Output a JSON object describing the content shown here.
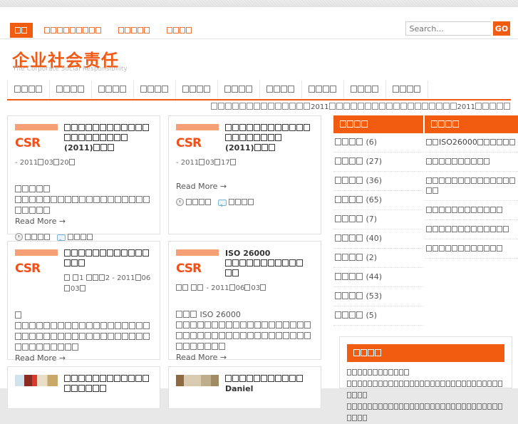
{
  "site": {
    "logo_cn": "企业社会责任",
    "logo_en": "The Corporate Social Responsibility",
    "accent_color": "#f25c11",
    "accent_dark": "#f05a14",
    "thumb_bar_color": "#f5a076"
  },
  "topbar": {
    "items": [
      {
        "label": "□□",
        "len": 2,
        "active": true
      },
      {
        "label": "□□□□□□□□□",
        "len": 9,
        "active": false
      },
      {
        "label": "□□□□□",
        "len": 5,
        "active": false
      },
      {
        "label": "□□□□",
        "len": 4,
        "active": false
      }
    ],
    "search": {
      "placeholder": "Search...",
      "value": "",
      "go_label": "GO"
    }
  },
  "mainnav": {
    "items": [
      {
        "label": "□□□□",
        "len": 4
      },
      {
        "label": "□□□□",
        "len": 4
      },
      {
        "label": "□□□□",
        "len": 4
      },
      {
        "label": "□□□□",
        "len": 4
      },
      {
        "label": "□□□□",
        "len": 4
      },
      {
        "label": "□□□□",
        "len": 4
      },
      {
        "label": "□□□□",
        "len": 4
      },
      {
        "label": "□□□□",
        "len": 4
      },
      {
        "label": "□□□□",
        "len": 4
      },
      {
        "label": "□□□□",
        "len": 4
      }
    ]
  },
  "ticker": {
    "segments": [
      {
        "type": "tofu",
        "len": 14
      },
      {
        "type": "text",
        "text": "2011"
      },
      {
        "type": "tofu",
        "len": 18
      },
      {
        "type": "text",
        "text": "2011"
      },
      {
        "type": "tofu",
        "len": 5
      }
    ]
  },
  "articles": [
    {
      "thumb": "csr-logo",
      "title_tofu": 21,
      "title_tail": "(2011)",
      "title_tofu2": 3,
      "date": "- 2011□03□20□",
      "date_prefix_tofu": 0,
      "excerpt_tofu_a": 5,
      "excerpt_tofu_b": 24,
      "read_more": "Read More →",
      "meta_time_tofu": 4,
      "meta_comment_tofu": 4
    },
    {
      "thumb": "csr-logo",
      "title_tofu": 20,
      "title_tail": "(2011)",
      "title_tofu2": 3,
      "date": "- 2011□03□17□",
      "date_prefix_tofu": 0,
      "excerpt_tofu_a": 0,
      "excerpt_tofu_b": 0,
      "read_more": "Read More →",
      "meta_time_tofu": 4,
      "meta_comment_tofu": 4
    },
    {
      "thumb": "csr-logo",
      "title_tofu": 15,
      "title_tail": "",
      "title_tofu2": 0,
      "date": "□ □1 □□□2 - 2011□06□03□",
      "date_prefix_tofu": 0,
      "excerpt_tofu_a": 1,
      "excerpt_tofu_b": 47,
      "read_more": "Read More →",
      "meta_time_tofu": 4,
      "meta_comment_tofu": 4
    },
    {
      "thumb": "csr-logo",
      "title_lead": "ISO 26000",
      "title_tofu": 11,
      "title_tail": "",
      "title_tofu2": 2,
      "date": "□□ □□ - 2011□06□03□",
      "date_prefix_tofu": 0,
      "excerpt_lead": "ISO 26000",
      "excerpt_tofu_a": 3,
      "excerpt_tofu_b": 45,
      "read_more": "Read More →",
      "meta_time_tofu": 4,
      "meta_comment_tofu": 4
    },
    {
      "thumb": "photo-1",
      "title_tofu": 18,
      "title_tail": "",
      "title_tofu2": 0,
      "date": "",
      "excerpt_tofu_a": 0,
      "excerpt_tofu_b": 0,
      "read_more": "",
      "meta_time_tofu": 0,
      "meta_comment_tofu": 0
    },
    {
      "thumb": "photo-2",
      "title_tofu": 11,
      "title_lead_tail": "Daniel",
      "title_tail": "",
      "title_tofu2": 0,
      "date": "",
      "excerpt_tofu_a": 0,
      "excerpt_tofu_b": 0,
      "read_more": "",
      "meta_time_tofu": 0,
      "meta_comment_tofu": 0
    }
  ],
  "sidebar": {
    "categories_widget": {
      "title_tofu": 4,
      "items": [
        {
          "label_tofu": 4,
          "count": "(6)"
        },
        {
          "label_tofu": 4,
          "count": "(27)"
        },
        {
          "label_tofu": 4,
          "count": "(36)"
        },
        {
          "label_tofu": 4,
          "count": "(65)"
        },
        {
          "label_tofu": 4,
          "count": "(7)"
        },
        {
          "label_tofu": 4,
          "count": "(40)"
        },
        {
          "label_tofu": 4,
          "count": "(2)"
        },
        {
          "label_tofu": 4,
          "count": "(44)"
        },
        {
          "label_tofu": 4,
          "count": "(53)"
        },
        {
          "label_tofu": 4,
          "count": "(5)"
        }
      ]
    },
    "recent_widget": {
      "title_tofu": 4,
      "items": [
        {
          "pre_tofu": 2,
          "text": "ISO26000",
          "post_tofu": 6
        },
        {
          "pre_tofu": 10,
          "text": "",
          "post_tofu": 0
        },
        {
          "pre_tofu": 16,
          "text": "",
          "post_tofu": 0
        },
        {
          "pre_tofu": 12,
          "text": "",
          "post_tofu": 0
        },
        {
          "pre_tofu": 13,
          "text": "",
          "post_tofu": 0
        },
        {
          "pre_tofu": 12,
          "text": "",
          "post_tofu": 0
        }
      ]
    },
    "about_widget": {
      "title_tofu": 4,
      "para_lines": [
        12,
        34,
        34
      ]
    }
  }
}
